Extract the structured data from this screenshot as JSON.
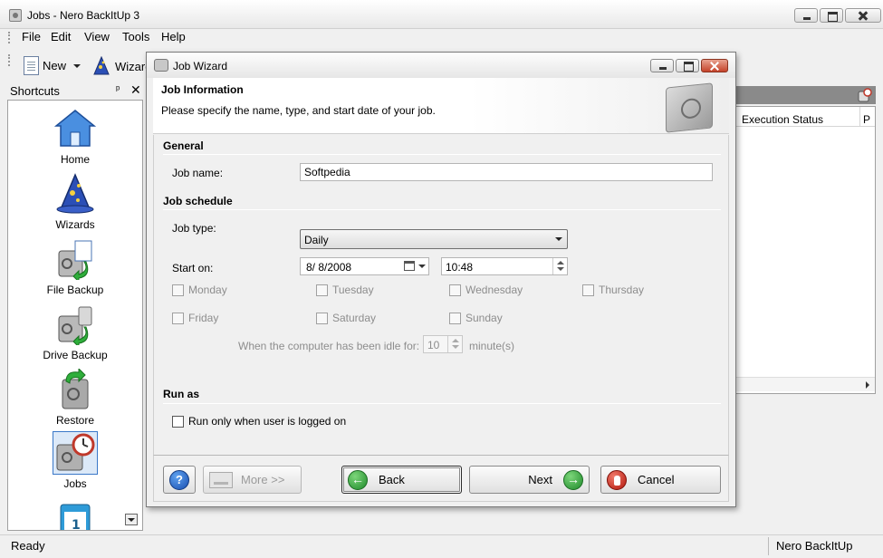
{
  "main_window": {
    "title": "Jobs - Nero BackItUp 3",
    "menu": [
      "File",
      "Edit",
      "View",
      "Tools",
      "Help"
    ],
    "toolbar": {
      "new_label": "New",
      "wizard_label": "Wizard"
    }
  },
  "shortcuts": {
    "header": "Shortcuts",
    "pin_glyph": "ᵖ",
    "close_glyph": "✕",
    "items": [
      {
        "label": "Home",
        "icon": "house-icon"
      },
      {
        "label": "Wizards",
        "icon": "wizard-hat-icon"
      },
      {
        "label": "File Backup",
        "icon": "file-backup-icon"
      },
      {
        "label": "Drive Backup",
        "icon": "drive-backup-icon"
      },
      {
        "label": "Restore",
        "icon": "restore-icon"
      },
      {
        "label": "Jobs",
        "icon": "jobs-clock-icon",
        "selected": true
      },
      {
        "label": "",
        "icon": "calendar-icon"
      }
    ]
  },
  "job_list": {
    "columns": [
      "Execution Status",
      "P"
    ]
  },
  "statusbar": {
    "left": "Ready",
    "right": "Nero BackItUp"
  },
  "dialog": {
    "title": "Job Wizard",
    "header": {
      "title": "Job Information",
      "description": "Please specify the name, type, and start date of your job."
    },
    "general": {
      "section": "General",
      "job_name_label": "Job name:",
      "job_name_value": "Softpedia"
    },
    "schedule": {
      "section": "Job schedule",
      "job_type_label": "Job type:",
      "job_type_value": "Daily",
      "start_on_label": "Start on:",
      "start_date": "8/ 8/2008",
      "start_time": "10:48",
      "days": [
        "Monday",
        "Tuesday",
        "Wednesday",
        "Thursday",
        "Friday",
        "Saturday",
        "Sunday"
      ],
      "idle_label": "When the computer has been idle for:",
      "idle_value": "10",
      "idle_unit": "minute(s)"
    },
    "run_as": {
      "section": "Run as",
      "logged_on_label": "Run only when user is logged on"
    },
    "footer": {
      "help": "?",
      "more": "More >>",
      "back": "Back",
      "next": "Next",
      "cancel": "Cancel"
    }
  },
  "colors": {
    "accent": "#3a78c8",
    "window_bg": "#f0f0f0"
  }
}
